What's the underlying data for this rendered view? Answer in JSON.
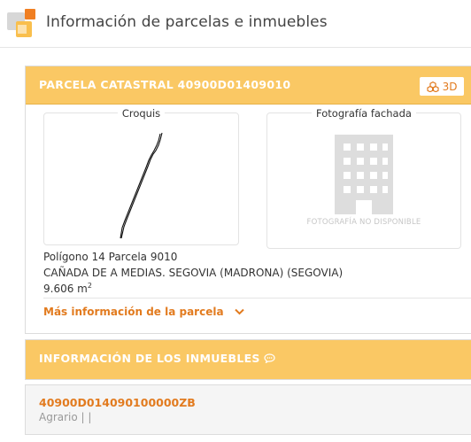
{
  "header": {
    "title": "Información de parcelas e inmuebles"
  },
  "parcel": {
    "title": "PARCELA CATASTRAL 40900D01409010",
    "btn_3d_label": "3D",
    "sketch_label": "Croquis",
    "photo_label": "Fotografía fachada",
    "no_photo": "FOTOGRAFÍA NO DISPONIBLE",
    "location": "Polígono 14 Parcela 9010",
    "address": "CAÑADA DE A MEDIAS. SEGOVIA (MADRONA) (SEGOVIA)",
    "area_value": "9.606 m",
    "area_unit_sup": "2",
    "more_info": "Más información de la parcela"
  },
  "properties": {
    "title": "INFORMACIÓN DE LOS INMUEBLES",
    "items": [
      {
        "reference": "40900D014090100000ZB",
        "use": "Agrario  |  |"
      }
    ]
  },
  "colors": {
    "accent": "#e27b1f",
    "header_band": "#fac864"
  },
  "icons": [
    "app-logo-icon",
    "3d-cubes-icon",
    "building-icon",
    "chevron-down-icon",
    "speech-bubble-icon"
  ]
}
